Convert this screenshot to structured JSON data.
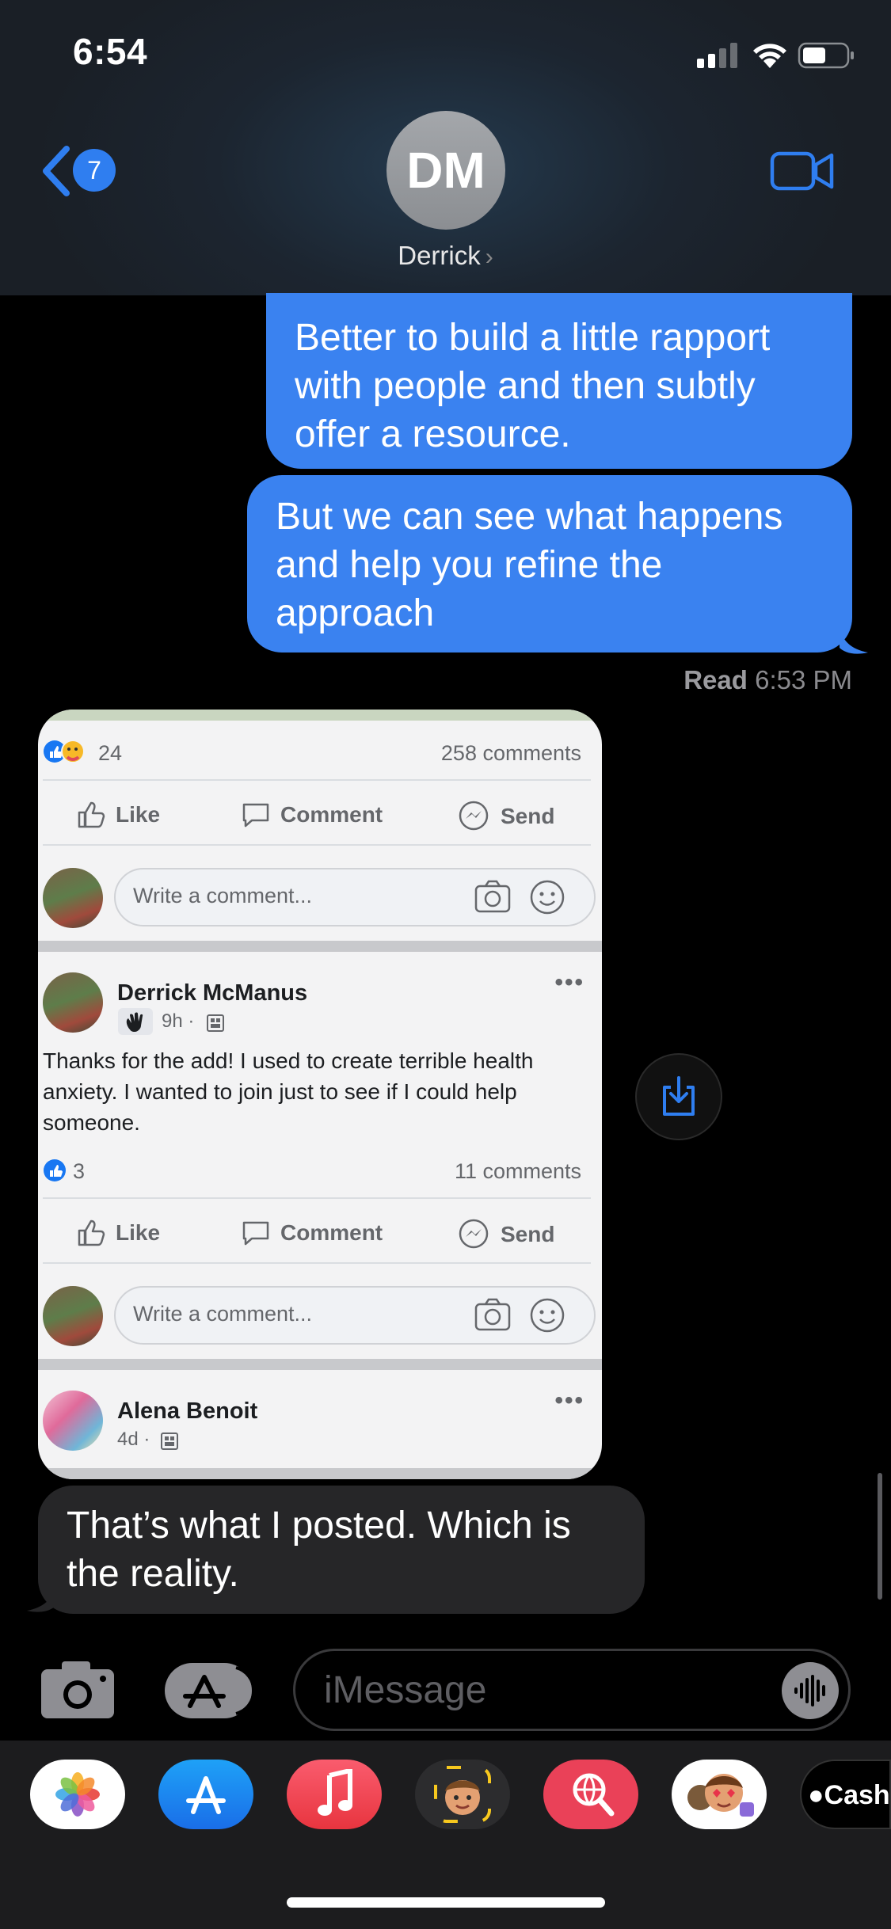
{
  "status_bar": {
    "time": "6:54"
  },
  "header": {
    "back_count": "7",
    "avatar_initials": "DM",
    "contact_name": "Derrick",
    "colors": {
      "accent": "#2f7ef0"
    }
  },
  "messages": {
    "outgoing_1": "Better to build a little rapport with people and then subtly offer a resource.",
    "outgoing_2": "But we can see what happens and help you refine the approach",
    "read_label": "Read",
    "read_time": "6:53 PM",
    "incoming_1": "That’s what I posted. Which is the reality."
  },
  "screenshot": {
    "post1": {
      "reaction_count": "24",
      "comments": "258 comments"
    },
    "actions": {
      "like": "Like",
      "comment": "Comment",
      "send": "Send"
    },
    "comment_placeholder": "Write a comment...",
    "post2": {
      "author": "Derrick McManus",
      "time": "9h ·",
      "text": "Thanks for the add! I used to create terrible health anxiety. I wanted to join just to see if I could help someone.",
      "reaction_count": "3",
      "comments": "11 comments"
    },
    "post3": {
      "author": "Alena Benoit",
      "time": "4d ·"
    }
  },
  "input": {
    "placeholder": "iMessage"
  },
  "app_tray": {
    "apps": [
      "photos-app",
      "app-store-app",
      "music-app",
      "memoji-app",
      "search-images-app",
      "animoji-stickers-app",
      "apple-cash-app"
    ],
    "cash_label": "Cash"
  }
}
